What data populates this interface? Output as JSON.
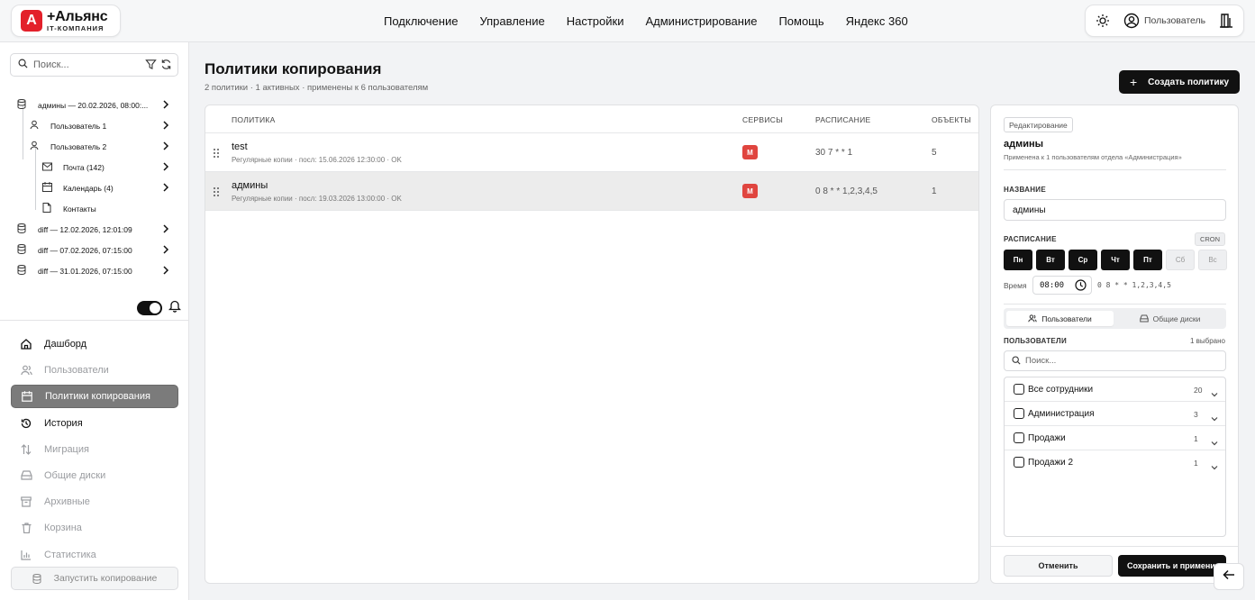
{
  "brand": {
    "mark": "A",
    "name": "+Альянс",
    "tagline": "IT-КОМПАНИЯ"
  },
  "nav": [
    "Подключение",
    "Управление",
    "Настройки",
    "Администрирование",
    "Помощь",
    "Яндекс 360"
  ],
  "user": {
    "name": "Пользователь"
  },
  "sidebar": {
    "search_placeholder": "Поиск...",
    "tree": [
      {
        "label": "админы — 20.02.2026, 08:00:...",
        "icon": "database-icon"
      },
      {
        "label": "Пользователь 1",
        "icon": "user-icon"
      },
      {
        "label": "Пользователь 2",
        "icon": "user-icon"
      },
      {
        "label": "Почта (142)",
        "icon": "mail-icon"
      },
      {
        "label": "Календарь (4)",
        "icon": "calendar-icon"
      },
      {
        "label": "Контакты",
        "icon": "document-icon"
      },
      {
        "label": "diff — 12.02.2026, 12:01:09",
        "icon": "database-icon"
      },
      {
        "label": "diff — 07.02.2026, 07:15:00",
        "icon": "database-icon"
      },
      {
        "label": "diff — 31.01.2026, 07:15:00",
        "icon": "database-icon"
      }
    ],
    "menu": [
      {
        "label": "Дашборд",
        "icon": "home-icon",
        "state": "dark"
      },
      {
        "label": "Пользователи",
        "icon": "users-icon",
        "state": "muted"
      },
      {
        "label": "Политики копирования",
        "icon": "calendar-icon",
        "state": "active"
      },
      {
        "label": "История",
        "icon": "history-icon",
        "state": "dark"
      },
      {
        "label": "Миграция",
        "icon": "migration-icon",
        "state": "muted"
      },
      {
        "label": "Общие диски",
        "icon": "shared-drive-icon",
        "state": "muted"
      },
      {
        "label": "Архивные",
        "icon": "archive-icon",
        "state": "muted"
      },
      {
        "label": "Корзина",
        "icon": "trash-icon",
        "state": "muted"
      },
      {
        "label": "Статистика",
        "icon": "stats-icon",
        "state": "muted"
      }
    ],
    "run_button": "Запустить копирование"
  },
  "main": {
    "title": "Политики копирования",
    "subtitle": "2 политики · 1 активных · применены к 6 пользователям",
    "create_button": "Создать политику",
    "columns": {
      "policy": "ПОЛИТИКА",
      "services": "СЕРВИСЫ",
      "schedule": "РАСПИСАНИЕ",
      "objects": "ОБЪЕКТЫ"
    },
    "rows": [
      {
        "name": "test",
        "meta": "Регулярные копии · посл: 15.06.2026 12:30:00 · OK",
        "service": "M",
        "schedule": "30 7 * * 1",
        "objects": "5"
      },
      {
        "name": "админы",
        "meta": "Регулярные копии · посл: 19.03.2026 13:00:00 · OK",
        "service": "M",
        "schedule": "0 8 * * 1,2,3,4,5",
        "objects": "1"
      }
    ]
  },
  "panel": {
    "badge": "Редактирование",
    "title": "админы",
    "description": "Применена к 1 пользователям отдела «Администрация»",
    "name_label": "НАЗВАНИЕ",
    "name_value": "админы",
    "schedule_label": "РАСПИСАНИЕ",
    "cron_badge": "CRON",
    "days": [
      {
        "label": "Пн",
        "on": true
      },
      {
        "label": "Вт",
        "on": true
      },
      {
        "label": "Ср",
        "on": true
      },
      {
        "label": "Чт",
        "on": true
      },
      {
        "label": "Пт",
        "on": true
      },
      {
        "label": "Сб",
        "on": false
      },
      {
        "label": "Вс",
        "on": false
      }
    ],
    "time_label": "Время",
    "time_value": "08:00",
    "cron_expression": "0 8 * * 1,2,3,4,5",
    "tab_users": "Пользователи",
    "tab_shared": "Общие диски",
    "users_label": "ПОЛЬЗОВАТЕЛИ",
    "selected_count": "1 выбрано",
    "search_placeholder": "Поиск...",
    "groups": [
      {
        "name": "Все сотрудники",
        "count": "20"
      },
      {
        "name": "Администрация",
        "count": "3"
      },
      {
        "name": "Продажи",
        "count": "1"
      },
      {
        "name": "Продажи 2",
        "count": "1"
      }
    ],
    "cancel_button": "Отменить",
    "save_button": "Сохранить и применить"
  },
  "colors": {
    "accent": "#111111",
    "brand": "#e3202a",
    "service_mail": "#e0453f",
    "active_menu": "#7b7b7b"
  }
}
